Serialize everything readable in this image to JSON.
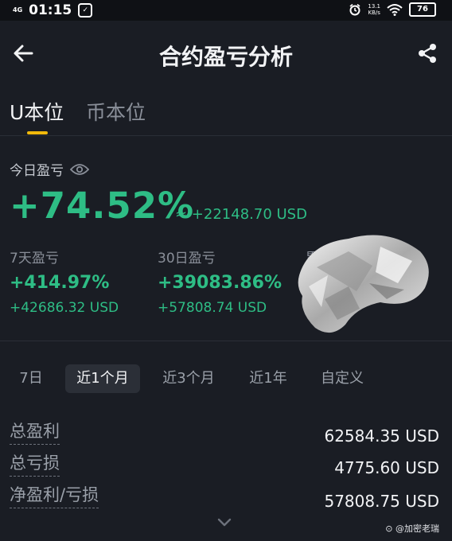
{
  "status_bar": {
    "network": "4G",
    "time": "01:15",
    "net_speed": "13.1",
    "net_unit": "KB/s",
    "battery": "76"
  },
  "header": {
    "title": "合约盈亏分析"
  },
  "tabs": [
    {
      "label": "U本位",
      "active": true
    },
    {
      "label": "币本位",
      "active": false
    }
  ],
  "today": {
    "label": "今日盈亏",
    "percent": "+74.52%",
    "usd": "≈ +22148.70 USD"
  },
  "stats": [
    {
      "label": "7天盈亏",
      "percent": "+414.97%",
      "usd": "+42686.32 USD"
    },
    {
      "label": "30日盈亏",
      "percent": "+39083.86%",
      "usd": "+57808.74 USD"
    },
    {
      "label": "累",
      "percent": "",
      "usd": ""
    }
  ],
  "periods": [
    {
      "label": "7日",
      "active": false
    },
    {
      "label": "近1个月",
      "active": true
    },
    {
      "label": "近3个月",
      "active": false
    },
    {
      "label": "近1年",
      "active": false
    },
    {
      "label": "自定义",
      "active": false
    }
  ],
  "summary": [
    {
      "label": "总盈利",
      "value": "62584.35 USD"
    },
    {
      "label": "总亏损",
      "value": "4775.60 USD"
    },
    {
      "label": "净盈利/亏损",
      "value": "57808.75 USD"
    }
  ],
  "watermark": "⊙ @加密老瑞",
  "colors": {
    "background": "#1a1d24",
    "positive": "#2ebd85",
    "accent": "#f0b90b"
  }
}
